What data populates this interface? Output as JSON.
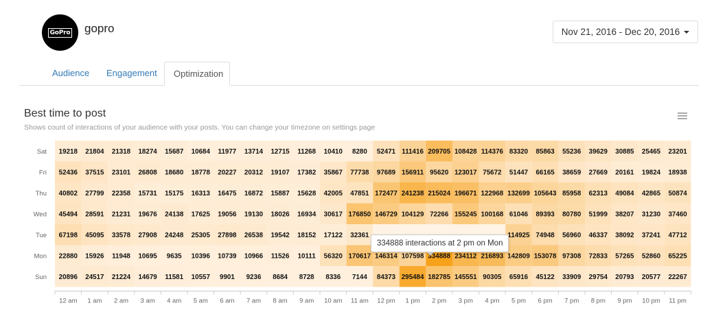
{
  "header": {
    "logo_text": "GoPro",
    "brand_name": "gopro",
    "date_range": "Nov 21, 2016 - Dec 20, 2016"
  },
  "tabs": [
    {
      "label": "Audience",
      "active": false
    },
    {
      "label": "Engagement",
      "active": false
    },
    {
      "label": "Optimization",
      "active": true
    }
  ],
  "chart_header": {
    "title": "Best time to post",
    "subtitle": "Shows count of interactions of your audience with your posts. You can change your timezone on settings page"
  },
  "tooltip": {
    "text": "334888 interactions at 2 pm on Mon"
  },
  "chart_data": {
    "type": "heatmap",
    "days": [
      "Sat",
      "Fri",
      "Thu",
      "Wed",
      "Tue",
      "Mon",
      "Sun"
    ],
    "hours": [
      "12 am",
      "1 am",
      "2 am",
      "3 am",
      "4 am",
      "5 am",
      "6 am",
      "7 am",
      "8 am",
      "9 am",
      "10 am",
      "11 am",
      "12 pm",
      "1 pm",
      "2 pm",
      "3 pm",
      "4 pm",
      "5 pm",
      "6 pm",
      "7 pm",
      "8 pm",
      "9 pm",
      "10 pm",
      "11 pm"
    ],
    "values": [
      [
        19218,
        21804,
        21318,
        18274,
        15687,
        10684,
        11977,
        13714,
        12715,
        11268,
        10410,
        8280,
        52471,
        111416,
        209705,
        108428,
        114376,
        83320,
        85863,
        55236,
        39629,
        30885,
        25465,
        23201
      ],
      [
        52436,
        37515,
        23101,
        26808,
        18680,
        18778,
        20227,
        20312,
        19107,
        17382,
        35867,
        77738,
        97689,
        156911,
        95620,
        123017,
        75672,
        51447,
        66165,
        38659,
        27669,
        20161,
        19824,
        18938
      ],
      [
        40802,
        27799,
        22358,
        15731,
        15175,
        16313,
        16475,
        16872,
        15887,
        15628,
        42005,
        47851,
        172477,
        241238,
        215024,
        196671,
        122968,
        132699,
        105643,
        85958,
        62313,
        49084,
        42865,
        50874
      ],
      [
        45494,
        28591,
        21231,
        19676,
        24138,
        17625,
        19056,
        19130,
        18026,
        16934,
        30617,
        176850,
        146729,
        104129,
        72266,
        155245,
        100168,
        61046,
        89393,
        80780,
        51999,
        38207,
        31230,
        37460
      ],
      [
        67198,
        45095,
        33578,
        27908,
        24248,
        25305,
        27898,
        26538,
        19542,
        18152,
        17122,
        32361,
        null,
        null,
        null,
        null,
        null,
        114925,
        74948,
        56960,
        46337,
        38092,
        37241,
        47712
      ],
      [
        22880,
        15926,
        11948,
        10695,
        9635,
        10396,
        10739,
        10966,
        11526,
        10111,
        56320,
        170617,
        146314,
        107598,
        334888,
        234112,
        216893,
        142809,
        153078,
        97308,
        72833,
        57265,
        52860,
        65225
      ],
      [
        20896,
        24517,
        21224,
        14679,
        11581,
        10557,
        9901,
        9236,
        8684,
        8728,
        8336,
        7144,
        84373,
        295484,
        182785,
        145551,
        90305,
        65916,
        45122,
        33909,
        29754,
        20793,
        20577,
        22267
      ]
    ],
    "max": 334888,
    "colors": {
      "low": "#fff3e6",
      "high": "#f7a21b",
      "text": "#111111"
    }
  }
}
